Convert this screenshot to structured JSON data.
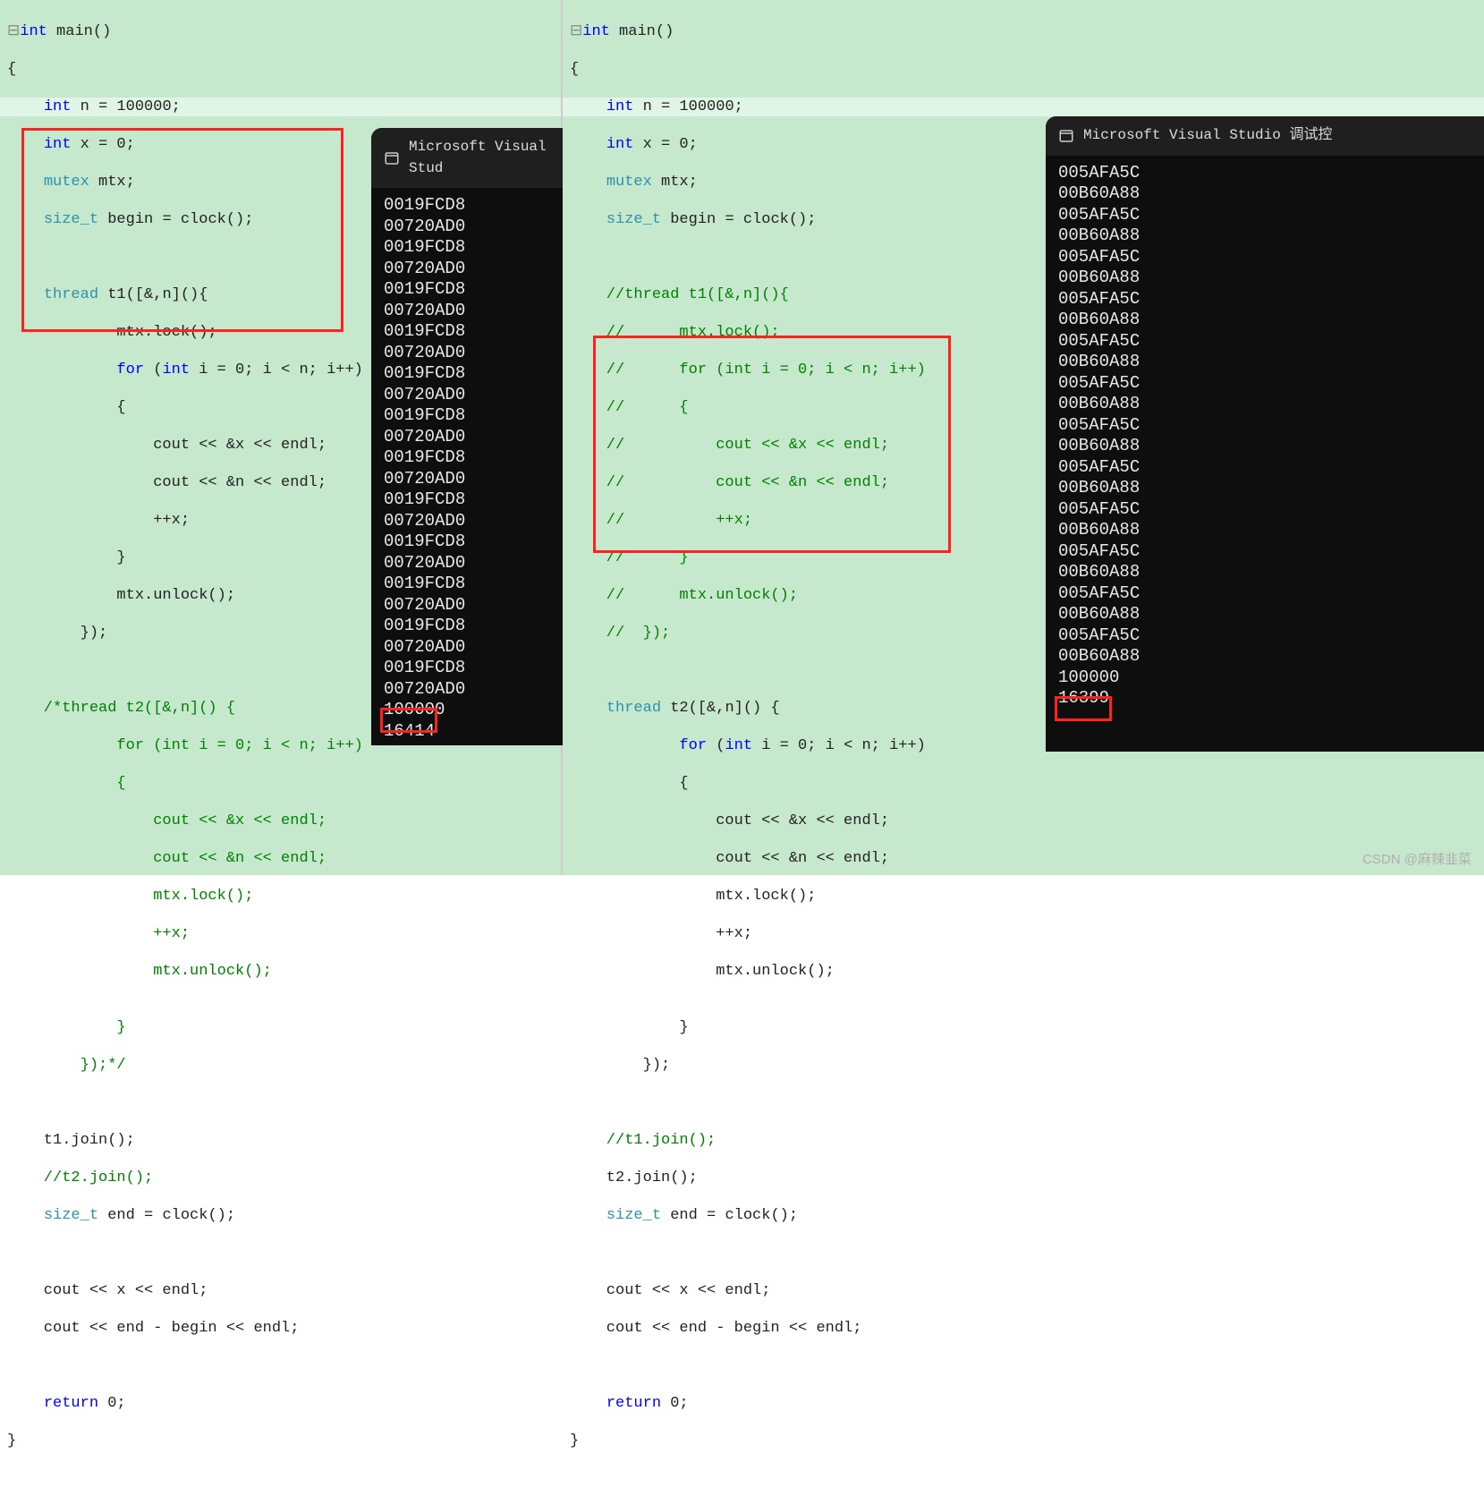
{
  "left": {
    "console_title": "Microsoft Visual Stud",
    "output_lines": [
      "0019FCD8",
      "00720AD0",
      "0019FCD8",
      "00720AD0",
      "0019FCD8",
      "00720AD0",
      "0019FCD8",
      "00720AD0",
      "0019FCD8",
      "00720AD0",
      "0019FCD8",
      "00720AD0",
      "0019FCD8",
      "00720AD0",
      "0019FCD8",
      "00720AD0",
      "0019FCD8",
      "00720AD0",
      "0019FCD8",
      "00720AD0",
      "0019FCD8",
      "00720AD0",
      "0019FCD8",
      "00720AD0",
      "100000",
      "16414"
    ],
    "code": {
      "l1a": "int",
      "l1b": " main()",
      "l2": "{",
      "l3a": "    ",
      "l3b": "int",
      "l3c": " n = 100000;",
      "l4a": "    ",
      "l4b": "int",
      "l4c": " x = 0;",
      "l5a": "    ",
      "l5b": "mutex",
      "l5c": " mtx;",
      "l6a": "    ",
      "l6b": "size_t",
      "l6c": " begin = clock();",
      "l8a": "    ",
      "l8b": "thread",
      "l8c": " t1([&,n](){",
      "l9": "            mtx.lock();",
      "l10a": "            ",
      "l10b": "for",
      "l10c": " (",
      "l10d": "int",
      "l10e": " i = 0; i < n; i++)",
      "l11": "            {",
      "l12": "                cout << &x << endl;",
      "l13": "                cout << &n << endl;",
      "l14": "                ++x;",
      "l15": "            }",
      "l16": "            mtx.unlock();",
      "l17": "        });",
      "c1": "    /*thread t2([&,n]() {",
      "c2": "            for (int i = 0; i < n; i++)",
      "c3": "            {",
      "c4": "                cout << &x << endl;",
      "c5": "                cout << &n << endl;",
      "c6": "                mtx.lock();",
      "c7": "                ++x;",
      "c8": "                mtx.unlock();",
      "c9": "",
      "c10": "            }",
      "c11": "        });*/",
      "l30": "    t1.join();",
      "l31": "    //t2.join();",
      "l32a": "    ",
      "l32b": "size_t",
      "l32c": " end = clock();",
      "l34": "    cout << x << endl;",
      "l35": "    cout << end - begin << endl;",
      "l37a": "    ",
      "l37b": "return",
      "l37c": " 0;",
      "l38": "}"
    }
  },
  "right": {
    "console_title": "Microsoft Visual Studio 调试控",
    "output_lines": [
      "005AFA5C",
      "00B60A88",
      "005AFA5C",
      "00B60A88",
      "005AFA5C",
      "00B60A88",
      "005AFA5C",
      "00B60A88",
      "005AFA5C",
      "00B60A88",
      "005AFA5C",
      "00B60A88",
      "005AFA5C",
      "00B60A88",
      "005AFA5C",
      "00B60A88",
      "005AFA5C",
      "00B60A88",
      "005AFA5C",
      "00B60A88",
      "005AFA5C",
      "00B60A88",
      "005AFA5C",
      "00B60A88",
      "100000",
      "16399"
    ],
    "code": {
      "l1a": "int",
      "l1b": " main()",
      "l2": "{",
      "l3a": "    ",
      "l3b": "int",
      "l3c": " n = 100000;",
      "l4a": "    ",
      "l4b": "int",
      "l4c": " x = 0;",
      "l5a": "    ",
      "l5b": "mutex",
      "l5c": " mtx;",
      "l6a": "    ",
      "l6b": "size_t",
      "l6c": " begin = clock();",
      "c1": "    //thread t1([&,n](){",
      "c2": "    //      mtx.lock();",
      "c3": "    //      for (int i = 0; i < n; i++)",
      "c4": "    //      {",
      "c5": "    //          cout << &x << endl;",
      "c6": "    //          cout << &n << endl;",
      "c7": "    //          ++x;",
      "c8": "    //      }",
      "c9": "    //      mtx.unlock();",
      "c10": "    //  });",
      "l8a": "    ",
      "l8b": "thread",
      "l8c": " t2([&,n]() {",
      "l10a": "            ",
      "l10b": "for",
      "l10c": " (",
      "l10d": "int",
      "l10e": " i = 0; i < n; i++)",
      "l11": "            {",
      "l12": "                cout << &x << endl;",
      "l13": "                cout << &n << endl;",
      "l14": "                mtx.lock();",
      "l15": "                ++x;",
      "l16": "                mtx.unlock();",
      "l17": "",
      "l18": "            }",
      "l19": "        });",
      "l30": "    //t1.join();",
      "l31": "    t2.join();",
      "l32a": "    ",
      "l32b": "size_t",
      "l32c": " end = clock();",
      "l34": "    cout << x << endl;",
      "l35": "    cout << end - begin << endl;",
      "l37a": "    ",
      "l37b": "return",
      "l37c": " 0;",
      "l38": "}"
    }
  },
  "watermark": "CSDN @麻辣韭菜"
}
